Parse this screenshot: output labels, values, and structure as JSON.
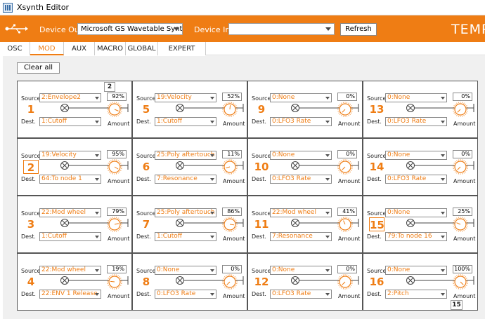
{
  "window": {
    "title": "Xsynth Editor"
  },
  "header": {
    "device_out_label": "Device Out:",
    "device_out_value": "Microsoft GS Wavetable Synth",
    "device_in_label": "Device In:",
    "device_in_value": "",
    "refresh_label": "Refresh",
    "brand": "TEMP"
  },
  "tabs": [
    {
      "label": "OSC"
    },
    {
      "label": "MOD"
    },
    {
      "label": "AUX"
    },
    {
      "label": "MACRO"
    },
    {
      "label": "GLOBAL"
    },
    {
      "label": "EXPERT MODE"
    }
  ],
  "active_tab": "MOD",
  "clear_all_label": "Clear all",
  "slot_labels": {
    "source": "Source",
    "dest": "Dest.",
    "amount": "Amount"
  },
  "colors": {
    "accent": "#ef7d14",
    "panel": "#f0f0f0"
  },
  "mod_slots": [
    {
      "num": "1",
      "source": "2:Envelope2",
      "amount_text": "92%",
      "amount": 0.92,
      "dest": "1:Cutoff"
    },
    {
      "num": "2",
      "source": "19:Velocity",
      "amount_text": "95%",
      "amount": 0.95,
      "dest": "64:To node 1"
    },
    {
      "num": "3",
      "source": "22:Mod wheel",
      "amount_text": "79%",
      "amount": 0.79,
      "dest": "1:Cutoff"
    },
    {
      "num": "4",
      "source": "22:Mod wheel",
      "amount_text": "19%",
      "amount": 0.19,
      "dest": "22:ENV 1 Release"
    },
    {
      "num": "5",
      "source": "19:Velocity",
      "amount_text": "52%",
      "amount": 0.52,
      "dest": "1:Cutoff"
    },
    {
      "num": "6",
      "source": "25:Poly aftertouch",
      "amount_text": "11%",
      "amount": 0.11,
      "dest": "7:Resonance"
    },
    {
      "num": "7",
      "source": "25:Poly aftertouch",
      "amount_text": "86%",
      "amount": 0.86,
      "dest": "1:Cutoff"
    },
    {
      "num": "8",
      "source": "0:None",
      "amount_text": "0%",
      "amount": 0.0,
      "dest": "0:LFO3 Rate"
    },
    {
      "num": "9",
      "source": "0:None",
      "amount_text": "0%",
      "amount": 0.0,
      "dest": "0:LFO3 Rate"
    },
    {
      "num": "10",
      "source": "0:None",
      "amount_text": "0%",
      "amount": 0.0,
      "dest": "0:LFO3 Rate"
    },
    {
      "num": "11",
      "source": "22:Mod wheel",
      "amount_text": "41%",
      "amount": 0.41,
      "dest": "7:Resonance"
    },
    {
      "num": "12",
      "source": "0:None",
      "amount_text": "0%",
      "amount": 0.0,
      "dest": "0:LFO3 Rate"
    },
    {
      "num": "13",
      "source": "0:None",
      "amount_text": "0%",
      "amount": 0.0,
      "dest": "0:LFO3 Rate"
    },
    {
      "num": "14",
      "source": "0:None",
      "amount_text": "0%",
      "amount": 0.0,
      "dest": "0:LFO3 Rate"
    },
    {
      "num": "15",
      "source": "0:None",
      "amount_text": "25%",
      "amount": 0.25,
      "dest": "79:To node 16"
    },
    {
      "num": "16",
      "source": "0:None",
      "amount_text": "100%",
      "amount": 1.0,
      "dest": "2:Pitch"
    }
  ],
  "badges": [
    {
      "text": "2"
    },
    {
      "text": "15"
    }
  ]
}
